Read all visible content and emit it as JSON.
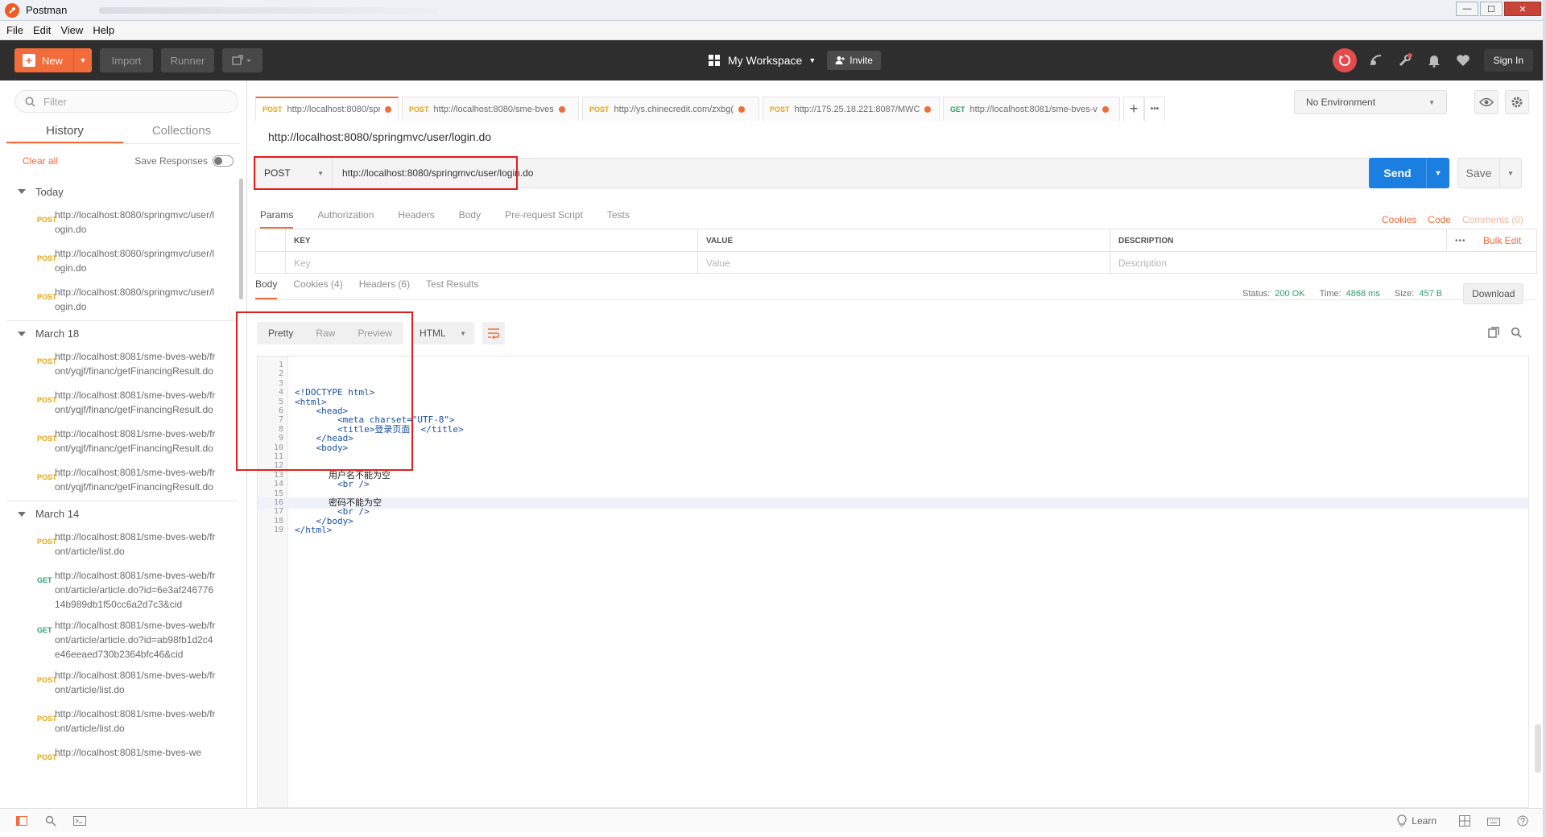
{
  "window": {
    "title": "Postman",
    "controls": {
      "minimize": "—",
      "maximize": "☐",
      "close": "✕"
    }
  },
  "menu": {
    "items": [
      "File",
      "Edit",
      "View",
      "Help"
    ]
  },
  "header": {
    "new_label": "New",
    "import_label": "Import",
    "runner_label": "Runner",
    "workspace_label": "My Workspace",
    "invite_label": "Invite",
    "signin_label": "Sign In",
    "colors": {
      "header_bg": "#2e2e2e",
      "accent": "#f26b3a",
      "sync": "#e24c4c"
    }
  },
  "sidebar": {
    "filter_placeholder": "Filter",
    "tabs": [
      {
        "label": "History",
        "active": true
      },
      {
        "label": "Collections",
        "active": false
      }
    ],
    "clear_all": "Clear all",
    "save_responses": "Save Responses",
    "groups": [
      {
        "label": "Today",
        "items": [
          {
            "method": "POST",
            "url": "http://localhost:8080/springmvc/user/login.do"
          },
          {
            "method": "POST",
            "url": "http://localhost:8080/springmvc/user/login.do"
          },
          {
            "method": "POST",
            "url": "http://localhost:8080/springmvc/user/login.do"
          }
        ]
      },
      {
        "label": "March 18",
        "items": [
          {
            "method": "POST",
            "url": "http://localhost:8081/sme-bves-web/front/yqjf/financ/getFinancingResult.do"
          },
          {
            "method": "POST",
            "url": "http://localhost:8081/sme-bves-web/front/yqjf/financ/getFinancingResult.do"
          },
          {
            "method": "POST",
            "url": "http://localhost:8081/sme-bves-web/front/yqjf/financ/getFinancingResult.do"
          },
          {
            "method": "POST",
            "url": "http://localhost:8081/sme-bves-web/front/yqjf/financ/getFinancingResult.do"
          }
        ]
      },
      {
        "label": "March 14",
        "items": [
          {
            "method": "POST",
            "url": "http://localhost:8081/sme-bves-web/front/article/list.do"
          },
          {
            "method": "GET",
            "url": "http://localhost:8081/sme-bves-web/front/article/article.do?id=6e3af24677614b989db1f50cc6a2d7c3&cid"
          },
          {
            "method": "GET",
            "url": "http://localhost:8081/sme-bves-web/front/article/article.do?id=ab98fb1d2c4e46eeaed730b2364bfc46&cid"
          },
          {
            "method": "POST",
            "url": "http://localhost:8081/sme-bves-web/front/article/list.do"
          },
          {
            "method": "POST",
            "url": "http://localhost:8081/sme-bves-web/front/article/list.do"
          },
          {
            "method": "POST",
            "url": "http://localhost:8081/sme-bves-we"
          }
        ]
      }
    ]
  },
  "request_tabs": [
    {
      "method": "POST",
      "url": "http://localhost:8080/springmvc",
      "active": true
    },
    {
      "method": "POST",
      "url": "http://localhost:8080/sme-bves",
      "active": false
    },
    {
      "method": "POST",
      "url": "http://ys.chinecredit.com/zxbg(",
      "active": false
    },
    {
      "method": "POST",
      "url": "http://175.25.18.221:8087/MWC",
      "active": false
    },
    {
      "method": "GET",
      "url": "http://localhost:8081/sme-bves-v",
      "active": false
    }
  ],
  "tab_actions": {
    "add": "+",
    "more": "•••"
  },
  "environment": {
    "selected": "No Environment"
  },
  "request": {
    "title": "http://localhost:8080/springmvc/user/login.do",
    "method": "POST",
    "url": "http://localhost:8080/springmvc/user/login.do",
    "send_label": "Send",
    "save_label": "Save"
  },
  "request_subtabs": [
    {
      "label": "Params",
      "active": true
    },
    {
      "label": "Authorization",
      "active": false
    },
    {
      "label": "Headers",
      "active": false
    },
    {
      "label": "Body",
      "active": false
    },
    {
      "label": "Pre-request Script",
      "active": false
    },
    {
      "label": "Tests",
      "active": false
    }
  ],
  "request_links": {
    "cookies": "Cookies",
    "code": "Code",
    "comments": "Comments (0)"
  },
  "params": {
    "headers": [
      "KEY",
      "VALUE",
      "DESCRIPTION"
    ],
    "placeholders": [
      "Key",
      "Value",
      "Description"
    ],
    "more": "•••",
    "bulk_edit": "Bulk Edit"
  },
  "response": {
    "tabs": [
      {
        "label": "Body",
        "active": true
      },
      {
        "label": "Cookies (4)",
        "active": false
      },
      {
        "label": "Headers (6)",
        "active": false
      },
      {
        "label": "Test Results",
        "active": false
      }
    ],
    "status_label": "Status:",
    "status_value": "200 OK",
    "time_label": "Time:",
    "time_value": "4868 ms",
    "size_label": "Size:",
    "size_value": "457 B",
    "download_label": "Download",
    "view_modes": [
      {
        "label": "Pretty",
        "active": true
      },
      {
        "label": "Raw",
        "active": false
      },
      {
        "label": "Preview",
        "active": false
      }
    ],
    "format": "HTML",
    "code_lines": [
      {
        "n": "1",
        "text": ""
      },
      {
        "n": "2",
        "text": ""
      },
      {
        "n": "3",
        "text": ""
      },
      {
        "n": "4",
        "text": "<!DOCTYPE html>"
      },
      {
        "n": "5",
        "text": "<html>"
      },
      {
        "n": "6",
        "text": "    <head>"
      },
      {
        "n": "7",
        "text": "        <meta charset=\"UTF-8\">"
      },
      {
        "n": "8",
        "text": "        <title>登录页面! </title>"
      },
      {
        "n": "9",
        "text": "    </head>"
      },
      {
        "n": "10",
        "text": "    <body>"
      },
      {
        "n": "11",
        "text": ""
      },
      {
        "n": "12",
        "text": ""
      },
      {
        "n": "13",
        "text": "            用户名不能为空"
      },
      {
        "n": "14",
        "text": "        <br />"
      },
      {
        "n": "15",
        "text": ""
      },
      {
        "n": "16",
        "text": "            密码不能为空"
      },
      {
        "n": "17",
        "text": "        <br />"
      },
      {
        "n": "18",
        "text": "    </body>"
      },
      {
        "n": "19",
        "text": "</html>"
      }
    ],
    "highlighted_line": "16"
  },
  "footer": {
    "learn_label": "Learn"
  }
}
